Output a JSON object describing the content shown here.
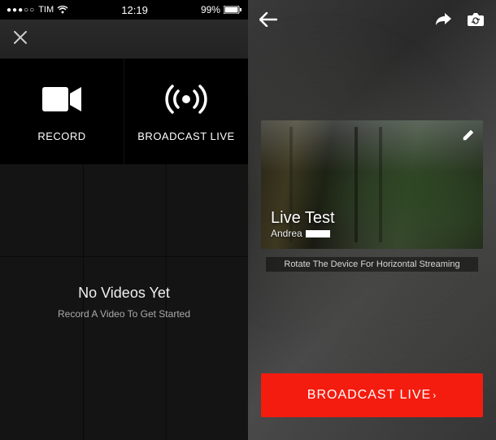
{
  "status_bar": {
    "carrier": "TIM",
    "time": "12:19",
    "battery_pct": "99%"
  },
  "left": {
    "tabs": {
      "record_label": "RECORD",
      "broadcast_label": "BROADCAST LIVE"
    },
    "empty": {
      "title": "No Videos Yet",
      "subtitle": "Record A Video To Get Started"
    }
  },
  "right": {
    "preview": {
      "title": "Live Test",
      "author": "Andrea"
    },
    "rotate_hint": "Rotate The Device For Horizontal Streaming",
    "broadcast_button": "BROADCAST LIVE"
  },
  "icons": {
    "close": "close-icon",
    "back": "back-arrow-icon",
    "share": "share-icon",
    "switch_camera": "switch-camera-icon",
    "edit": "pencil-edit-icon",
    "record": "video-camera-icon",
    "broadcast": "broadcast-signal-icon",
    "wifi": "wifi-icon"
  },
  "colors": {
    "accent_red": "#f41c0f",
    "bg_dark": "#141414"
  }
}
